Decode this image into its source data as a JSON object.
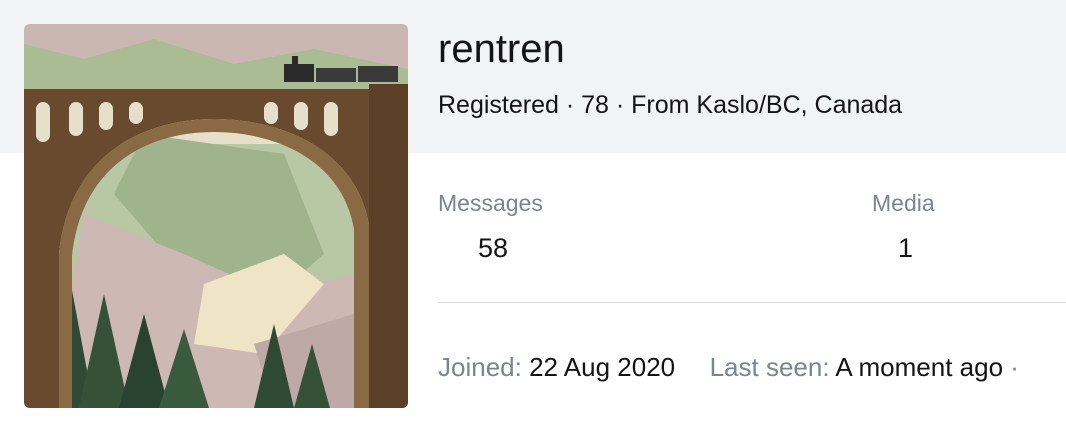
{
  "profile": {
    "username": "rentren",
    "blurb": "Registered · 78 · From Kaslo/BC, Canada",
    "stats": [
      {
        "label": "Messages",
        "value": "58"
      },
      {
        "label": "Media",
        "value": "1"
      }
    ],
    "joined_label": "Joined:",
    "joined_value": "22 Aug 2020",
    "last_seen_label": "Last seen:",
    "last_seen_value": "A moment ago",
    "trailing_separator": "·"
  },
  "avatar": {
    "icon": "avatar-image",
    "colors": {
      "sky": "#e9e4d2",
      "bridge": "#6a4a2e",
      "mountain_green": "#9fb48c",
      "rock_pink": "#c9b2ad",
      "trees": "#2f4a34"
    }
  }
}
